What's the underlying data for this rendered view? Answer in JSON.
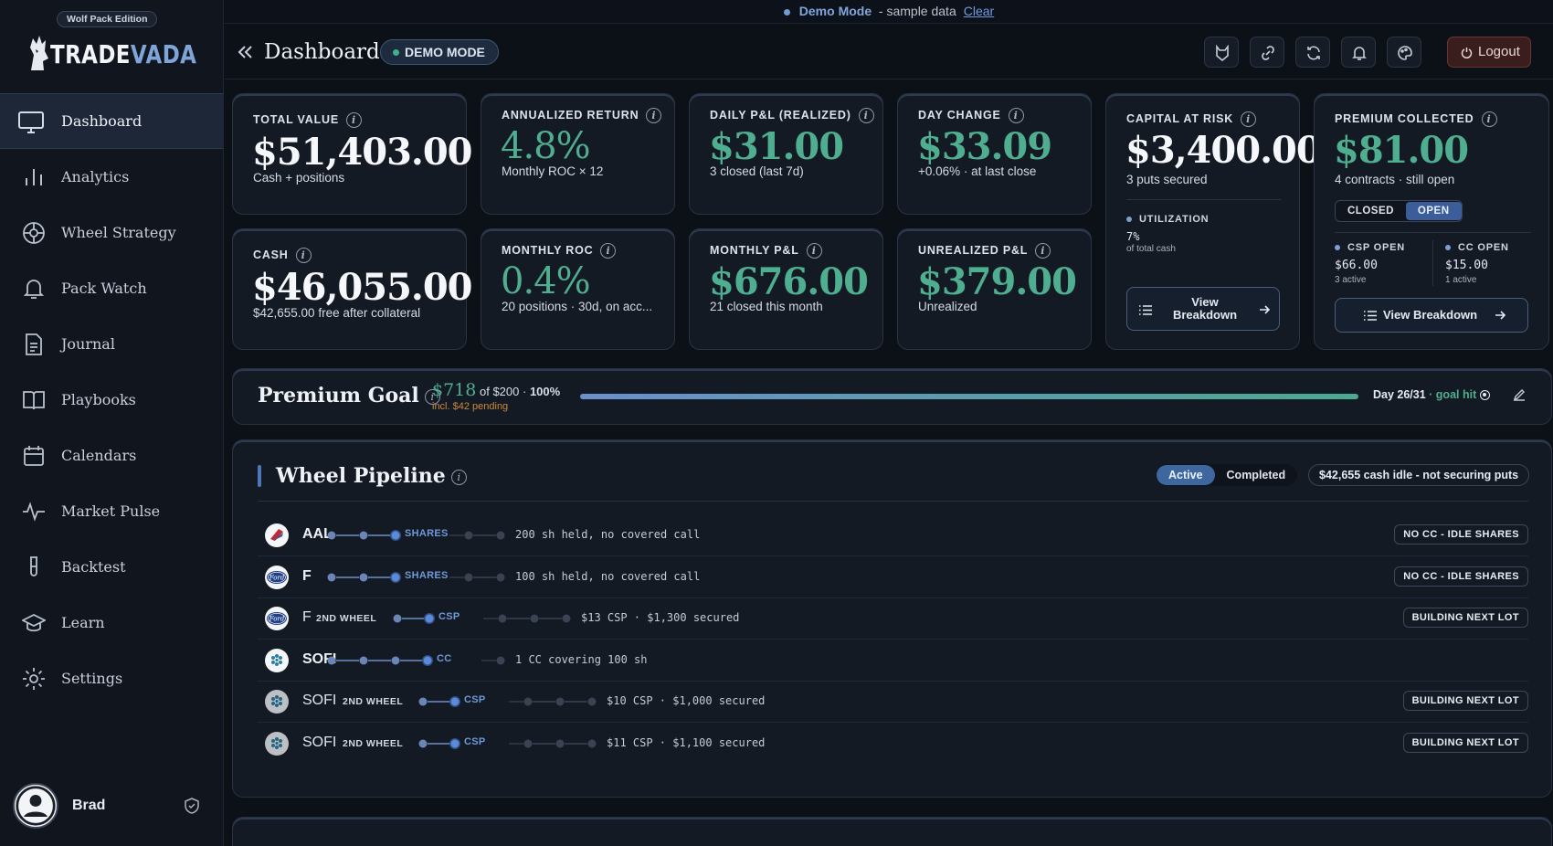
{
  "banner": {
    "mode": "Demo Mode",
    "text": "- sample data",
    "clear": "Clear"
  },
  "sidebar": {
    "edition": "Wolf Pack Edition",
    "brand_a": "TRADE",
    "brand_b": "VADA",
    "items": [
      {
        "label": "Dashboard",
        "icon": "monitor-icon"
      },
      {
        "label": "Analytics",
        "icon": "bar-chart-icon"
      },
      {
        "label": "Wheel Strategy",
        "icon": "wheel-icon"
      },
      {
        "label": "Pack Watch",
        "icon": "bell-icon"
      },
      {
        "label": "Journal",
        "icon": "document-icon"
      },
      {
        "label": "Playbooks",
        "icon": "book-icon"
      },
      {
        "label": "Calendars",
        "icon": "calendar-icon"
      },
      {
        "label": "Market Pulse",
        "icon": "pulse-icon"
      },
      {
        "label": "Backtest",
        "icon": "test-tube-icon"
      },
      {
        "label": "Learn",
        "icon": "graduation-cap-icon"
      },
      {
        "label": "Settings",
        "icon": "gear-icon"
      }
    ],
    "user": "Brad"
  },
  "header": {
    "title": "Dashboard",
    "demo_pill": "DEMO MODE",
    "logout": "Logout"
  },
  "cards": {
    "total_value": {
      "label": "TOTAL VALUE",
      "value": "$51,403.00",
      "sub": "Cash + positions"
    },
    "annualized": {
      "label": "ANNUALIZED RETURN",
      "value": "4.8%",
      "sub": "Monthly ROC × 12"
    },
    "daily_pl": {
      "label": "DAILY P&L (REALIZED)",
      "value": "$31.00",
      "sub": "3 closed (last 7d)"
    },
    "day_change": {
      "label": "DAY CHANGE",
      "value": "$33.09",
      "sub": "+0.06% · at last close"
    },
    "cash": {
      "label": "CASH",
      "value": "$46,055.00",
      "sub": "$42,655.00 free after collateral"
    },
    "monthly_roc": {
      "label": "MONTHLY ROC",
      "value": "0.4%",
      "sub": "20 positions · 30d, on acc..."
    },
    "monthly_pl": {
      "label": "MONTHLY P&L",
      "value": "$676.00",
      "sub": "21 closed this month"
    },
    "unrealized": {
      "label": "UNREALIZED P&L",
      "value": "$379.00",
      "sub": "Unrealized"
    },
    "capital_risk": {
      "label": "CAPITAL AT RISK",
      "value": "$3,400.00",
      "sub": "3 puts secured",
      "util_label": "UTILIZATION",
      "util_value": "7%",
      "util_sub": "of total cash",
      "button": "View Breakdown"
    },
    "premium": {
      "label": "PREMIUM COLLECTED",
      "value": "$81.00",
      "sub": "4 contracts · still open",
      "seg_closed": "CLOSED",
      "seg_open": "OPEN",
      "csp_label": "CSP OPEN",
      "csp_value": "$66.00",
      "csp_sub": "3 active",
      "cc_label": "CC OPEN",
      "cc_value": "$15.00",
      "cc_sub": "1 active",
      "button": "View Breakdown"
    }
  },
  "goal": {
    "title": "Premium Goal",
    "amount": "$718",
    "of": "of $200 · ",
    "pct": "100%",
    "pending": "incl. $42 pending",
    "progress": 1.0,
    "day": "Day 26/31",
    "hit": " · goal hit"
  },
  "pipeline": {
    "title": "Wheel Pipeline",
    "tab_active": "Active",
    "tab_completed": "Completed",
    "idle": "$42,655 cash idle - not securing puts",
    "rows": [
      {
        "ticker": "AAL",
        "second": "",
        "stage": "SHARES",
        "stage_index": 2,
        "desc": "200 sh held, no covered call",
        "status": "NO CC - IDLE SHARES"
      },
      {
        "ticker": "F",
        "second": "",
        "stage": "SHARES",
        "stage_index": 2,
        "desc": "100 sh held, no covered call",
        "status": "NO CC - IDLE SHARES"
      },
      {
        "ticker": "F",
        "second": "2ND WHEEL",
        "stage": "CSP",
        "stage_index": 1,
        "desc": "$13 CSP · $1,300 secured",
        "status": "BUILDING NEXT LOT"
      },
      {
        "ticker": "SOFI",
        "second": "",
        "stage": "CC",
        "stage_index": 3,
        "desc": "1 CC covering 100 sh",
        "status": ""
      },
      {
        "ticker": "SOFI",
        "second": "2ND WHEEL",
        "stage": "CSP",
        "stage_index": 1,
        "desc": "$10 CSP · $1,000 secured",
        "status": "BUILDING NEXT LOT"
      },
      {
        "ticker": "SOFI",
        "second": "2ND WHEEL",
        "stage": "CSP",
        "stage_index": 1,
        "desc": "$11 CSP · $1,100 secured",
        "status": "BUILDING NEXT LOT"
      }
    ]
  },
  "colors": {
    "accent": "#4d77b8",
    "green": "#4fae8f",
    "pending": "#c98a3c",
    "bg": "#0c1017"
  }
}
